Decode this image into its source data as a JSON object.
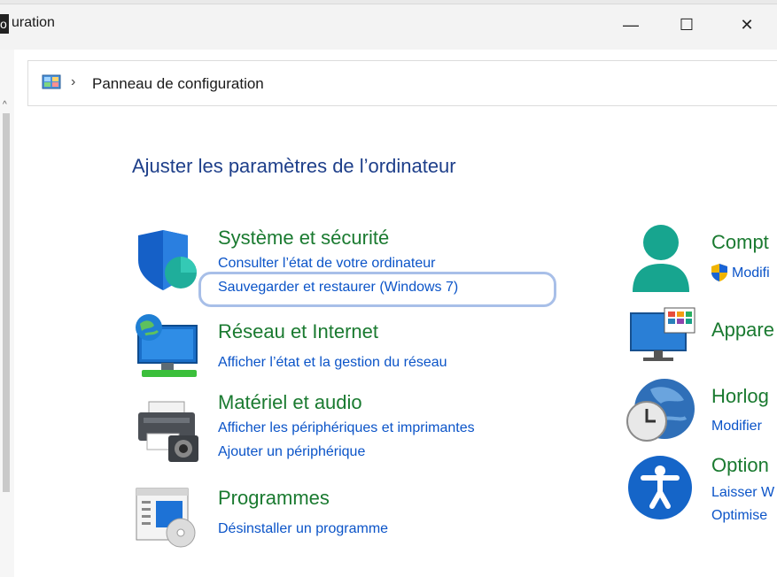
{
  "window": {
    "title": "uration",
    "minimize_glyph": "—",
    "maximize_glyph": "☐",
    "close_glyph": "✕"
  },
  "address": {
    "separator": "›",
    "path": "Panneau de configuration",
    "icon": "control-panel-icon"
  },
  "main": {
    "heading": "Ajuster les paramètres de l’ordinateur"
  },
  "categories": [
    {
      "title": "Système et sécurité",
      "icon": "shield-icon",
      "links": [
        "Consulter l’état de votre ordinateur",
        "Sauvegarder et restaurer (Windows 7)"
      ]
    },
    {
      "title": "Réseau et Internet",
      "icon": "network-globe-icon",
      "links": [
        "Afficher l’état et la gestion du réseau"
      ]
    },
    {
      "title": "Matériel et audio",
      "icon": "printer-icon",
      "links": [
        "Afficher les périphériques et imprimantes",
        "Ajouter un périphérique"
      ]
    },
    {
      "title": "Programmes",
      "icon": "programs-icon",
      "links": [
        "Désinstaller un programme"
      ]
    }
  ],
  "right_categories": [
    {
      "title": "Compt",
      "icon": "user-accounts-icon",
      "links": [
        "Modifi"
      ]
    },
    {
      "title": "Appare",
      "icon": "appearance-monitor-icon",
      "links": []
    },
    {
      "title": "Horlog",
      "icon": "clock-globe-icon",
      "links": [
        "Modifier"
      ]
    },
    {
      "title": "Option",
      "icon": "accessibility-icon",
      "links": [
        "Laisser W",
        "Optimise"
      ]
    }
  ],
  "colors": {
    "category_green": "#1a7a30",
    "link_blue": "#0b54c8",
    "heading_blue": "#1e3f8a",
    "focus_ring": "#a8bfe8"
  }
}
